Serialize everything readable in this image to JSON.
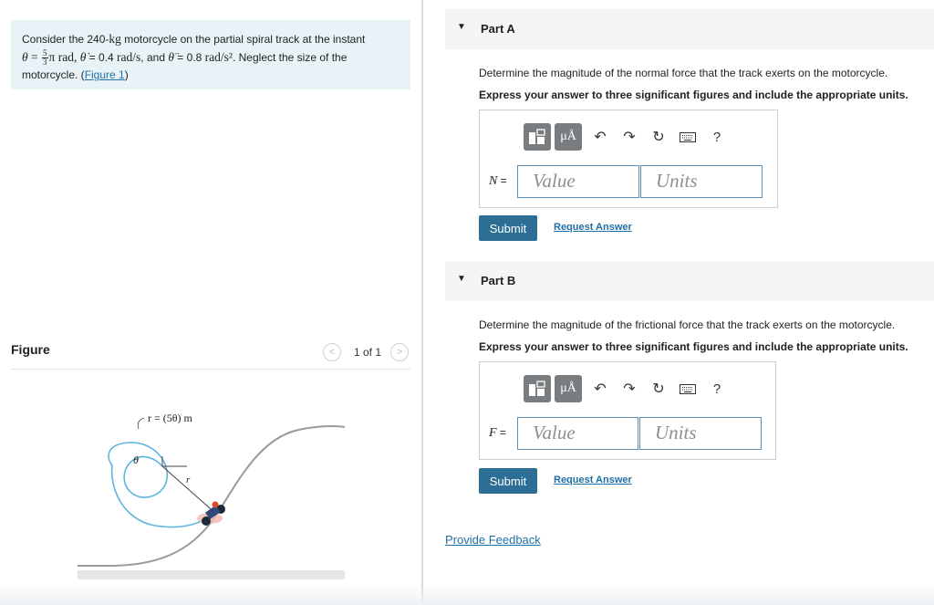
{
  "problem": {
    "line1": "Consider the 240-",
    "kg": "kg",
    "line1_rest": " motorcycle on the partial spiral track at the instant",
    "theta": "θ",
    "eq": " = ",
    "frac_num": "5",
    "frac_den": "3",
    "pi_rad": "π rad, ",
    "theta_dot": "θ̇",
    "dot_val": " = 0.4 ",
    "rad_s": "rad/s",
    "and": ", and ",
    "theta_ddot": "θ̈",
    "ddot_val": " = 0.8 ",
    "rad_s2": "rad/s²",
    "line2_rest": ". Neglect the size of the",
    "line3": "motorcycle. (",
    "figure_link": "Figure 1",
    "line3_close": ")"
  },
  "figure_section": {
    "title": "Figure",
    "pager_text": "1 of 1",
    "prev": "<",
    "next": ">",
    "label_r_eq": "r = (5θ) m",
    "label_theta": "θ",
    "label_r": "r"
  },
  "partA": {
    "title": "Part A",
    "question": "Determine the magnitude of the normal force that the track exerts on the motorcycle.",
    "instruction": "Express your answer to three significant figures and include the appropriate units.",
    "var": "N",
    "eq": " =",
    "value_placeholder": "Value",
    "units_placeholder": "Units",
    "submit": "Submit",
    "request": "Request Answer"
  },
  "partB": {
    "title": "Part B",
    "question": "Determine the magnitude of the frictional force that the track exerts on the motorcycle.",
    "instruction": "Express your answer to three significant figures and include the appropriate units.",
    "var": "F",
    "eq": " =",
    "value_placeholder": "Value",
    "units_placeholder": "Units",
    "submit": "Submit",
    "request": "Request Answer"
  },
  "toolbar": {
    "units_btn": "μÅ",
    "help": "?",
    "icons": [
      "template-icon",
      "units-icon",
      "undo-icon",
      "redo-icon",
      "reset-icon",
      "keyboard-icon",
      "help-icon"
    ]
  },
  "feedback": "Provide Feedback",
  "colors": {
    "problem_bg": "#e8f3f7",
    "link": "#1f6fa8",
    "submit_bg": "#2d6f94",
    "field_border": "#5d8fb5",
    "spiral": "#5fb3e0",
    "toolbar_btn": "#7a7d80"
  }
}
